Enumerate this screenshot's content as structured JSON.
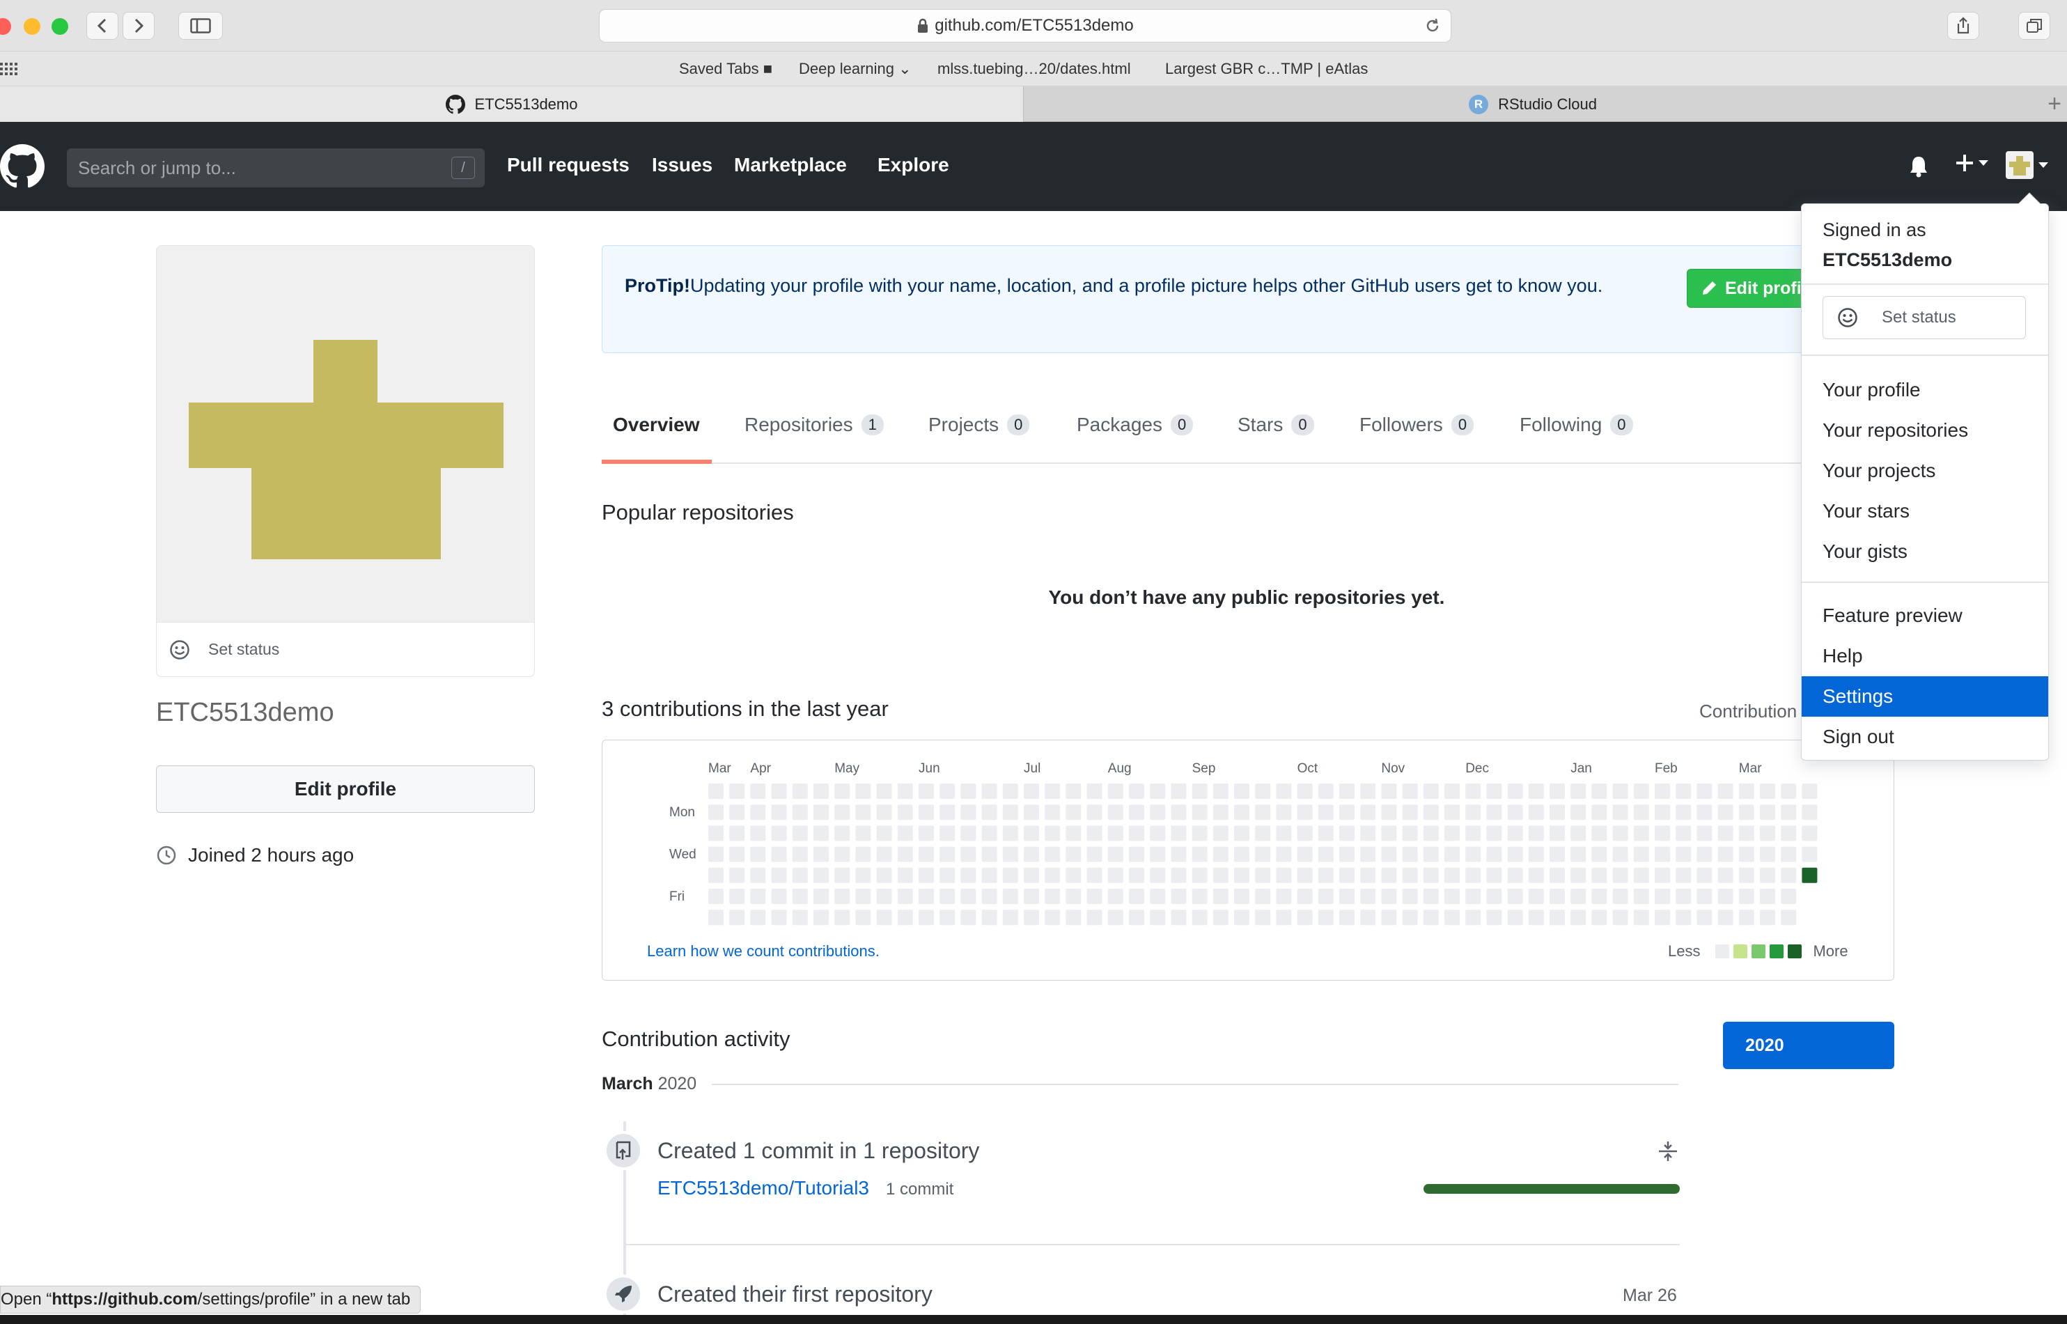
{
  "browser": {
    "url": "github.com/ETC5513demo",
    "bookmarks": [
      "Saved Tabs",
      "Deep learning",
      "mlss.tuebing…20/dates.html",
      "Largest GBR c…TMP | eAtlas"
    ],
    "tabs": [
      {
        "label": "ETC5513demo",
        "active": true
      },
      {
        "label": "RStudio Cloud",
        "active": false
      }
    ]
  },
  "header": {
    "search_placeholder": "Search or jump to...",
    "search_shortcut": "/",
    "nav": [
      "Pull requests",
      "Issues",
      "Marketplace",
      "Explore"
    ]
  },
  "sidebar": {
    "set_status": "Set status",
    "username": "ETC5513demo",
    "edit_profile": "Edit profile",
    "joined": "Joined 2 hours ago"
  },
  "protip": {
    "lead": "ProTip!",
    "text": " Updating your profile with your name, location, and a profile picture helps other GitHub users get to know you.",
    "button": "Edit profile"
  },
  "profile_tabs": [
    {
      "label": "Overview",
      "count": ""
    },
    {
      "label": "Repositories",
      "count": "1"
    },
    {
      "label": "Projects",
      "count": "0"
    },
    {
      "label": "Packages",
      "count": "0"
    },
    {
      "label": "Stars",
      "count": "0"
    },
    {
      "label": "Followers",
      "count": "0"
    },
    {
      "label": "Following",
      "count": "0"
    }
  ],
  "popular": {
    "title": "Popular repositories",
    "empty": "You don’t have any public repositories yet."
  },
  "contributions": {
    "title": "3 contributions in the last year",
    "settings": "Contribution settings",
    "months": [
      "Mar",
      "Apr",
      "May",
      "Jun",
      "Jul",
      "Aug",
      "Sep",
      "Oct",
      "Nov",
      "Dec",
      "Jan",
      "Feb",
      "Mar"
    ],
    "days": [
      "Mon",
      "Wed",
      "Fri"
    ],
    "learn": "Learn how we count contributions.",
    "less": "Less",
    "more": "More",
    "weeks": 53,
    "last_week_days": 5,
    "active_cell": {
      "week": 52,
      "day": 4,
      "level": 4
    },
    "colors": [
      "#ebedf0",
      "#c6e48b",
      "#7bc96f",
      "#239a3b",
      "#196127"
    ]
  },
  "activity": {
    "title": "Contribution activity",
    "year": "2020",
    "month": "March",
    "month_year": "2020",
    "commit_title": "Created 1 commit in 1 repository",
    "repo": "ETC5513demo/Tutorial3",
    "repo_count": "1 commit",
    "commit_share": 1.0,
    "first_repo_title": "Created their first repository",
    "first_repo_date": "Mar 26"
  },
  "dropdown": {
    "signed_in_as": "Signed in as",
    "user": "ETC5513demo",
    "set_status": "Set status",
    "group1": [
      "Your profile",
      "Your repositories",
      "Your projects",
      "Your stars",
      "Your gists"
    ],
    "group2": [
      "Feature preview",
      "Help",
      "Settings",
      "Sign out"
    ],
    "highlighted": "Settings"
  },
  "status_bar": {
    "pre": "Open “",
    "url_bold": "https://github.com",
    "url_rest": "/settings/profile",
    "post": "” in a new tab"
  }
}
